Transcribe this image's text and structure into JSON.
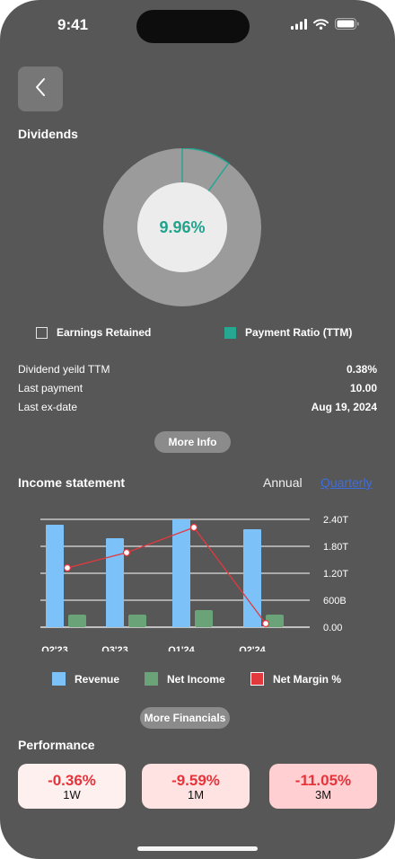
{
  "status_bar": {
    "time": "9:41"
  },
  "dividends": {
    "title": "Dividends",
    "payout_ratio_text": "9.96%",
    "payout_fraction": 0.0996,
    "legend": {
      "retained": "Earnings Retained",
      "payment": "Payment Ratio (TTM)"
    },
    "rows": [
      {
        "label": "Dividend yeild TTM",
        "value": "0.38%"
      },
      {
        "label": "Last payment",
        "value": "10.00"
      },
      {
        "label": "Last ex-date",
        "value": "Aug 19, 2024"
      }
    ],
    "more_info_label": "More Info"
  },
  "income": {
    "title": "Income statement",
    "tabs": {
      "annual": "Annual",
      "quarterly": "Quarterly",
      "active": "quarterly"
    },
    "legend": {
      "revenue": "Revenue",
      "net_income": "Net Income",
      "net_margin": "Net Margin %"
    },
    "more_label": "More Financials"
  },
  "chart_data": {
    "type": "bar",
    "categories": [
      "Q2'23",
      "Q3'23",
      "Q1'24",
      "Q2'24"
    ],
    "y_ticks": [
      "2.40T",
      "1.80T",
      "1.20T",
      "600B",
      "0.00"
    ],
    "ylim": [
      0,
      2.4
    ],
    "series": [
      {
        "name": "Revenue",
        "values": [
          2.28,
          1.98,
          2.4,
          2.18
        ]
      },
      {
        "name": "Net Income",
        "values": [
          0.28,
          0.28,
          0.38,
          0.28
        ]
      },
      {
        "name": "Net Margin %",
        "values": [
          1.32,
          1.66,
          2.22,
          0.08
        ]
      }
    ],
    "grid": true,
    "legend_position": "bottom"
  },
  "performance": {
    "title": "Performance",
    "cards": [
      {
        "pct": "-0.36%",
        "period": "1W"
      },
      {
        "pct": "-9.59%",
        "period": "1M"
      },
      {
        "pct": "-11.05%",
        "period": "3M"
      }
    ]
  },
  "colors": {
    "background": "#575757",
    "teal": "#26a792",
    "revenue_bar": "#7cc1f8",
    "net_income_bar": "#6aa377",
    "net_margin_line": "#e2393f",
    "card_red": "#e8333a"
  }
}
